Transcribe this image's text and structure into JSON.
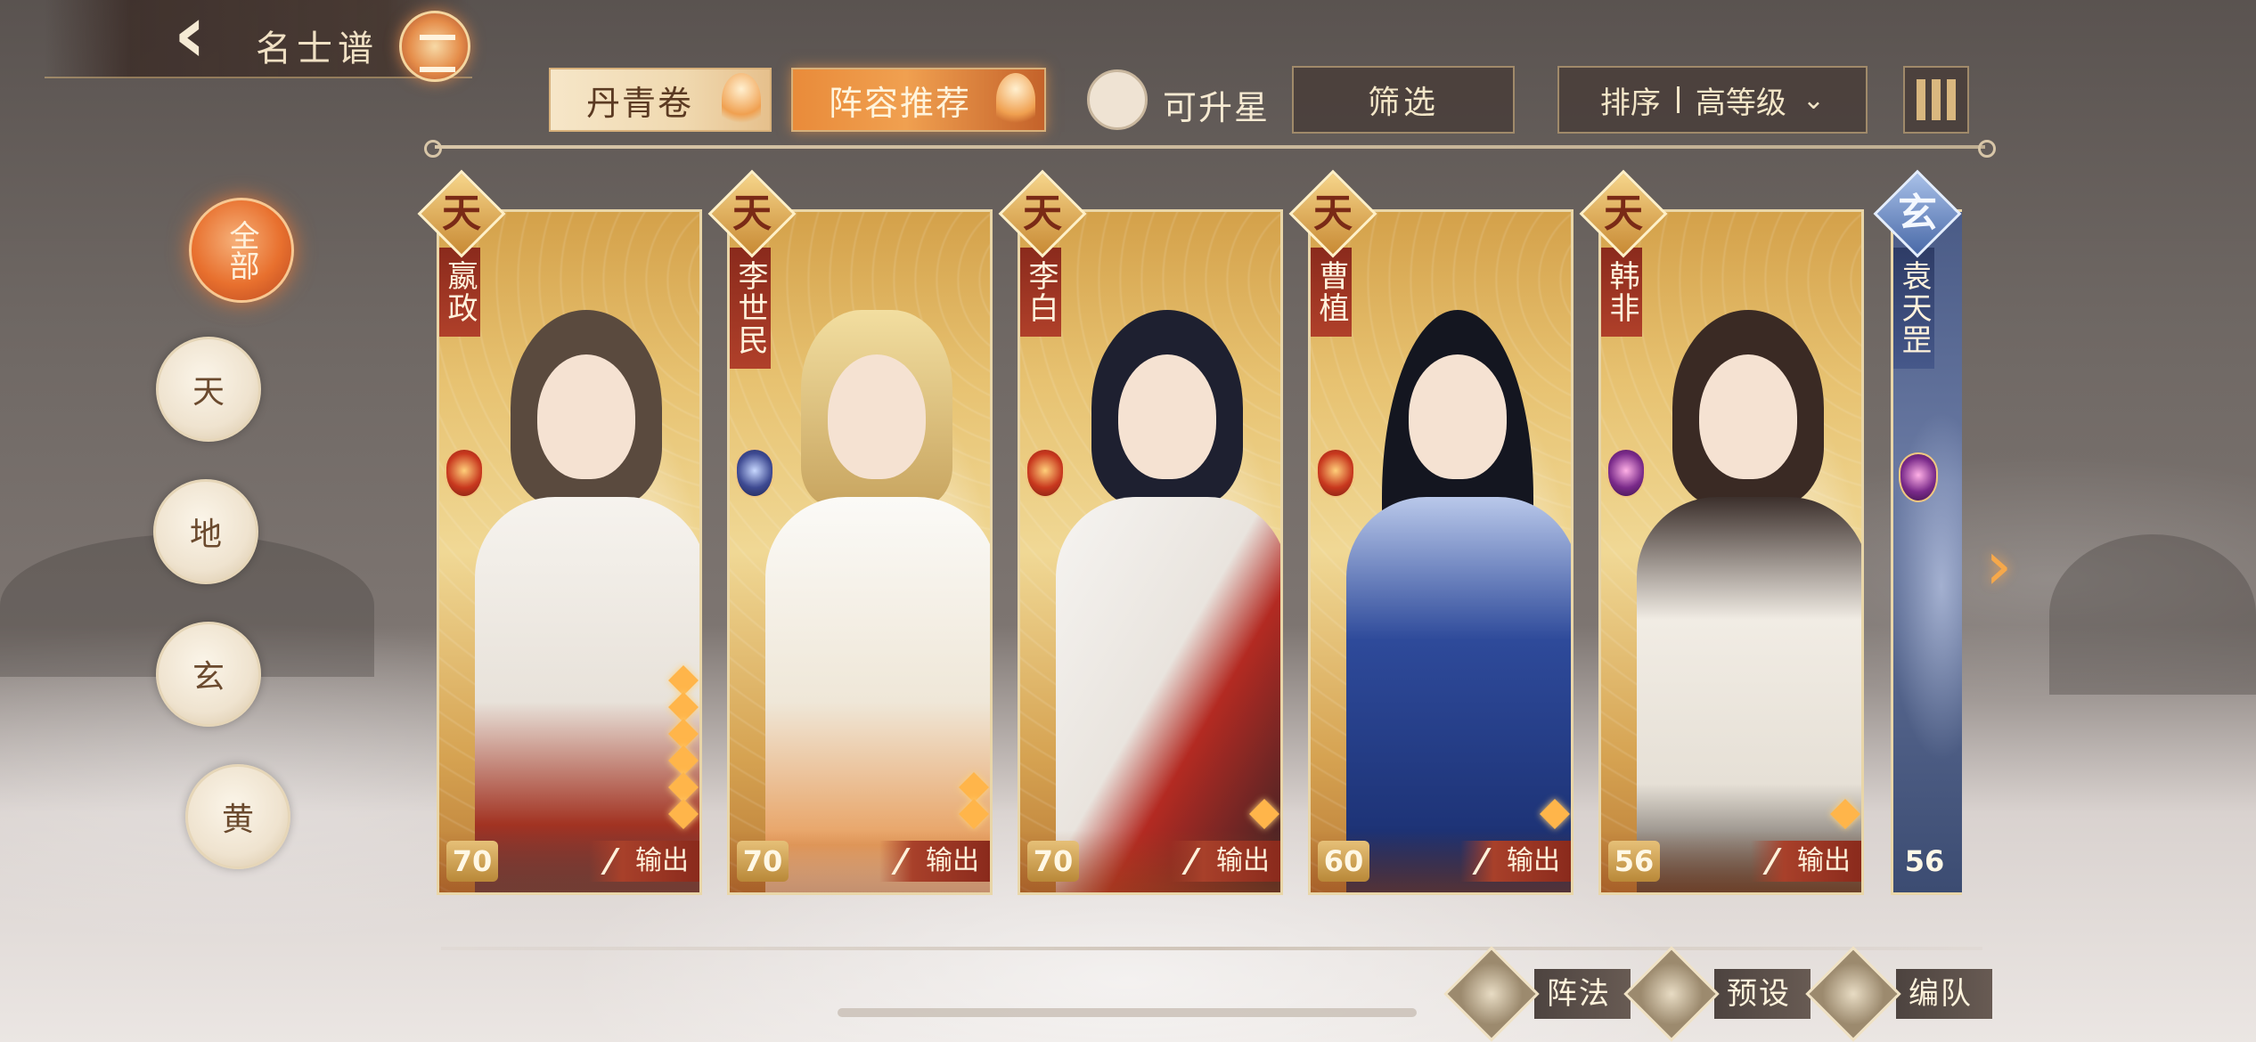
{
  "header": {
    "title": "名士谱",
    "back_icon": "back-arrow-icon",
    "emblem_icon": "pavilion-emblem-icon"
  },
  "tabs": [
    {
      "label": "丹青卷",
      "active": false
    },
    {
      "label": "阵容推荐",
      "active": true
    }
  ],
  "controls": {
    "upgradable_label": "可升星",
    "filter_label": "筛选",
    "sort_label": "排序",
    "sort_value": "高等级",
    "menu_icon": "list-view-icon"
  },
  "rank_filters": [
    {
      "label": "全部",
      "active": true
    },
    {
      "label": "天",
      "active": false
    },
    {
      "label": "地",
      "active": false
    },
    {
      "label": "玄",
      "active": false
    },
    {
      "label": "黄",
      "active": false
    }
  ],
  "cards": [
    {
      "tier": "天",
      "name": "嬴政",
      "level": "70",
      "role": "输出",
      "stars": 6,
      "element": "fire-emblem-icon"
    },
    {
      "tier": "天",
      "name": "李世民",
      "level": "70",
      "role": "输出",
      "stars": 2,
      "element": "water-emblem-icon"
    },
    {
      "tier": "天",
      "name": "李白",
      "level": "70",
      "role": "输出",
      "stars": 1,
      "element": "fire-emblem-icon"
    },
    {
      "tier": "天",
      "name": "曹植",
      "level": "60",
      "role": "输出",
      "stars": 1,
      "element": "fire-emblem-icon"
    },
    {
      "tier": "天",
      "name": "韩非",
      "level": "56",
      "role": "输出",
      "stars": 1,
      "element": "thunder-emblem-icon"
    },
    {
      "tier": "玄",
      "name": "袁天罡",
      "level": "56",
      "role": "",
      "stars": 0,
      "element": "thunder-emblem-icon"
    }
  ],
  "bottom_buttons": [
    {
      "label": "阵法",
      "icon": "formation-icon"
    },
    {
      "label": "预设",
      "icon": "preset-icon"
    },
    {
      "label": "编队",
      "icon": "team-flag-icon"
    }
  ],
  "colors": {
    "accent_orange": "#e8702e",
    "card_gold": "#e7c271",
    "role_red": "#a8402a",
    "xuan_blue": "#4a5b86"
  }
}
